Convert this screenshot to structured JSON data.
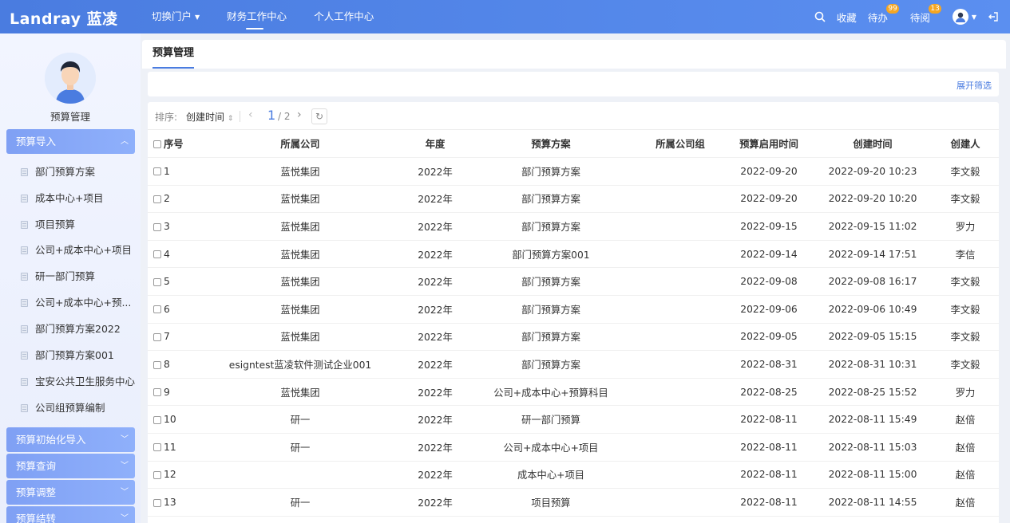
{
  "app": {
    "logo": "Landray 蓝凌",
    "nav": [
      {
        "label": "切换门户"
      },
      {
        "label": "财务工作中心"
      },
      {
        "label": "个人工作中心"
      }
    ],
    "top_right": {
      "collect": "收藏",
      "todo": "待办",
      "todo_count": "99",
      "toread": "待阅",
      "toread_count": "13"
    }
  },
  "sidebar": {
    "title": "预算管理",
    "groups": [
      {
        "label": "预算导入",
        "expanded": true
      },
      {
        "label": "预算初始化导入"
      },
      {
        "label": "预算查询"
      },
      {
        "label": "预算调整"
      },
      {
        "label": "预算结转"
      }
    ],
    "items": [
      {
        "label": "部门预算方案"
      },
      {
        "label": "成本中心+项目"
      },
      {
        "label": "项目预算"
      },
      {
        "label": "公司+成本中心+项目"
      },
      {
        "label": "研一部门预算"
      },
      {
        "label": "公司+成本中心+预..."
      },
      {
        "label": "部门预算方案2022"
      },
      {
        "label": "部门预算方案001"
      },
      {
        "label": "宝安公共卫生服务中心"
      },
      {
        "label": "公司组预算编制"
      }
    ]
  },
  "main": {
    "tab": "预算管理",
    "filter_link": "展开筛选",
    "toolbar": {
      "sort_label": "排序:",
      "sort_value": "创建时间",
      "page_current": "1",
      "page_total": "/ 2"
    },
    "columns": [
      "序号",
      "所属公司",
      "年度",
      "预算方案",
      "所属公司组",
      "预算启用时间",
      "创建时间",
      "创建人"
    ],
    "rows": [
      {
        "seq": "1",
        "company": "蓝悦集团",
        "year": "2022年",
        "plan": "部门预算方案",
        "group": "",
        "start": "2022-09-20",
        "created": "2022-09-20 10:23",
        "creator": "李文毅"
      },
      {
        "seq": "2",
        "company": "蓝悦集团",
        "year": "2022年",
        "plan": "部门预算方案",
        "group": "",
        "start": "2022-09-20",
        "created": "2022-09-20 10:20",
        "creator": "李文毅"
      },
      {
        "seq": "3",
        "company": "蓝悦集团",
        "year": "2022年",
        "plan": "部门预算方案",
        "group": "",
        "start": "2022-09-15",
        "created": "2022-09-15 11:02",
        "creator": "罗力"
      },
      {
        "seq": "4",
        "company": "蓝悦集团",
        "year": "2022年",
        "plan": "部门预算方案001",
        "group": "",
        "start": "2022-09-14",
        "created": "2022-09-14 17:51",
        "creator": "李信"
      },
      {
        "seq": "5",
        "company": "蓝悦集团",
        "year": "2022年",
        "plan": "部门预算方案",
        "group": "",
        "start": "2022-09-08",
        "created": "2022-09-08 16:17",
        "creator": "李文毅"
      },
      {
        "seq": "6",
        "company": "蓝悦集团",
        "year": "2022年",
        "plan": "部门预算方案",
        "group": "",
        "start": "2022-09-06",
        "created": "2022-09-06 10:49",
        "creator": "李文毅"
      },
      {
        "seq": "7",
        "company": "蓝悦集团",
        "year": "2022年",
        "plan": "部门预算方案",
        "group": "",
        "start": "2022-09-05",
        "created": "2022-09-05 15:15",
        "creator": "李文毅"
      },
      {
        "seq": "8",
        "company": "esigntest蓝凌软件测试企业001",
        "year": "2022年",
        "plan": "部门预算方案",
        "group": "",
        "start": "2022-08-31",
        "created": "2022-08-31 10:31",
        "creator": "李文毅"
      },
      {
        "seq": "9",
        "company": "蓝悦集团",
        "year": "2022年",
        "plan": "公司+成本中心+预算科目",
        "group": "",
        "start": "2022-08-25",
        "created": "2022-08-25 15:52",
        "creator": "罗力"
      },
      {
        "seq": "10",
        "company": "研一",
        "year": "2022年",
        "plan": "研一部门预算",
        "group": "",
        "start": "2022-08-11",
        "created": "2022-08-11 15:49",
        "creator": "赵倍"
      },
      {
        "seq": "11",
        "company": "研一",
        "year": "2022年",
        "plan": "公司+成本中心+项目",
        "group": "",
        "start": "2022-08-11",
        "created": "2022-08-11 15:03",
        "creator": "赵倍"
      },
      {
        "seq": "12",
        "company": "",
        "year": "2022年",
        "plan": "成本中心+项目",
        "group": "",
        "start": "2022-08-11",
        "created": "2022-08-11 15:00",
        "creator": "赵倍"
      },
      {
        "seq": "13",
        "company": "研一",
        "year": "2022年",
        "plan": "项目预算",
        "group": "",
        "start": "2022-08-11",
        "created": "2022-08-11 14:55",
        "creator": "赵倍"
      }
    ]
  }
}
